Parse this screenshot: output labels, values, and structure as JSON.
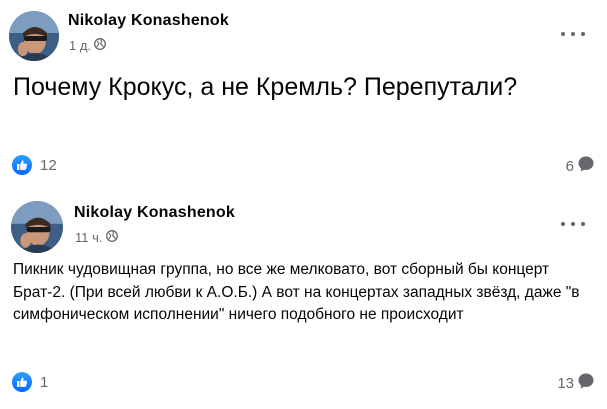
{
  "posts": [
    {
      "author": "Nikolay Konashenok",
      "time": "1 д.",
      "audience_icon": "globe-icon",
      "text": "Почему Крокус, а не Кремль? Перепутали?",
      "reactions_count": "12",
      "comments_count": "6"
    },
    {
      "author": "Nikolay Konashenok",
      "time": "11 ч.",
      "audience_icon": "globe-icon",
      "text": "Пикник чудовищная группа, но все же мелковато, вот сборный бы концерт Брат-2. (При всей любви к А.О.Б.) А вот на концертах западных звёзд, даже \"в симфоническом исполнении\" ничего подобного не происходит",
      "reactions_count": "1",
      "comments_count": "13"
    }
  ],
  "colors": {
    "text": "#050505",
    "secondary": "#65676b",
    "like_blue": "#0866ff",
    "background": "#ffffff"
  }
}
